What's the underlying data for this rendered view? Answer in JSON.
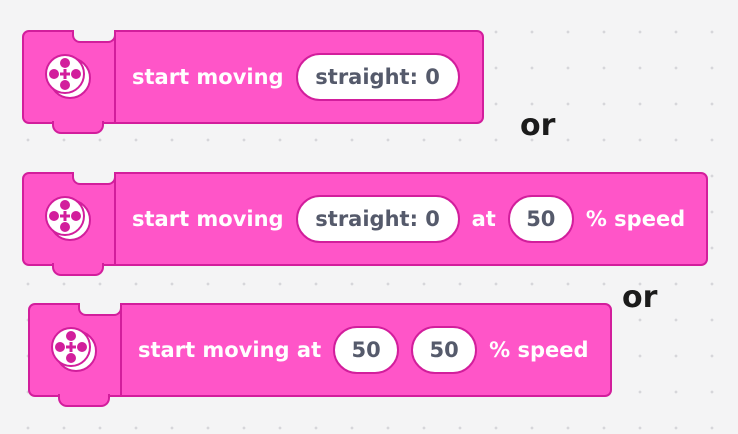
{
  "blocks": [
    {
      "icon": "motor-pair-icon",
      "label": "start moving",
      "steering": "straight: 0"
    },
    {
      "icon": "motor-pair-icon",
      "label": "start moving",
      "steering": "straight: 0",
      "at_label": "at",
      "speed": "50",
      "speed_suffix": "% speed"
    },
    {
      "icon": "motor-pair-icon",
      "label": "start moving at",
      "left_speed": "50",
      "right_speed": "50",
      "speed_suffix": "% speed"
    }
  ],
  "separators": [
    "or",
    "or"
  ],
  "colors": {
    "block_fill": "#ff55c8",
    "block_border": "#d21e9c",
    "input_fill": "#ffffff",
    "input_text": "#555a6b",
    "label_text": "#ffffff"
  }
}
